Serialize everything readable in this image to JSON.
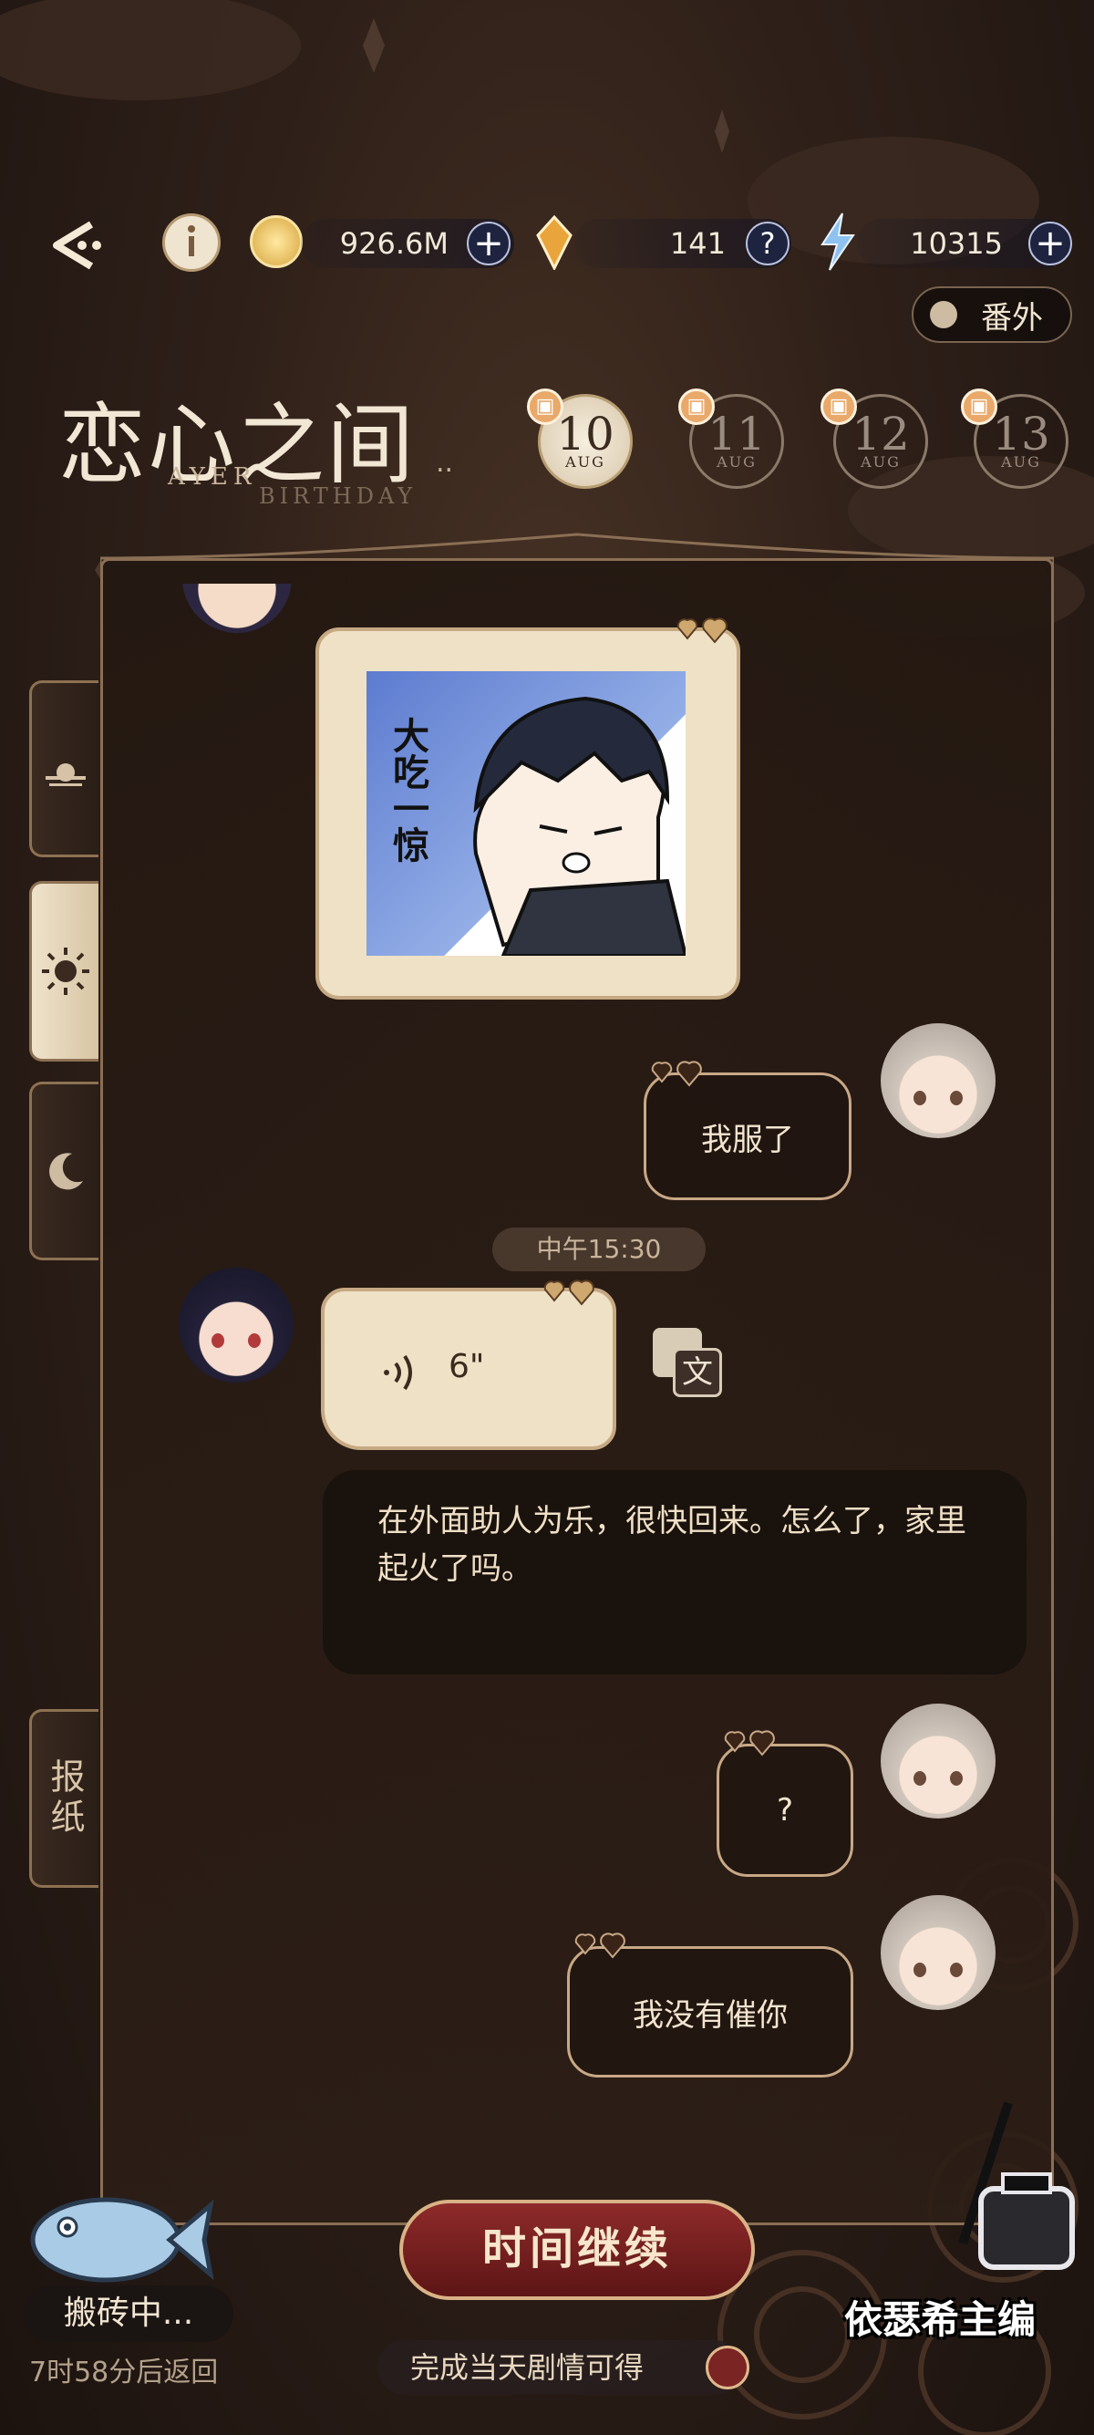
{
  "topbar": {
    "coins": "926.6M",
    "gems": "141",
    "energy": "10315",
    "help_symbol": "?",
    "plus_symbol": "+"
  },
  "extra_button": {
    "label": "番外"
  },
  "title": {
    "main": "恋心之间",
    "sub_left": "AYER",
    "sub_right": "BIRTHDAY",
    "ellipsis": ".."
  },
  "dates": [
    {
      "day": "10",
      "month": "AUG",
      "active": true
    },
    {
      "day": "11",
      "month": "AUG",
      "active": false
    },
    {
      "day": "12",
      "month": "AUG",
      "active": false
    },
    {
      "day": "13",
      "month": "AUG",
      "active": false
    }
  ],
  "side_tabs": {
    "newspaper": "报纸"
  },
  "sticker": {
    "text": "大吃一惊"
  },
  "messages": {
    "player_1": "我服了",
    "time_stamp": "中午15:30",
    "voice_duration": "6\"",
    "translate_icon_text": "文",
    "npc_text": "在外面助人为乐，很快回来。怎么了，家里起火了吗。",
    "player_2": "?",
    "player_3": "我没有催你"
  },
  "bottom": {
    "continue_button": "时间继续",
    "reward_text": "完成当天剧情可得",
    "status": "搬砖中...",
    "return_time": "7时58分后返回",
    "watermark": "依瑟希主编"
  },
  "colors": {
    "accent_gold": "#c6a983",
    "button_red": "#8e2a2a",
    "cream": "#efe1c5"
  }
}
